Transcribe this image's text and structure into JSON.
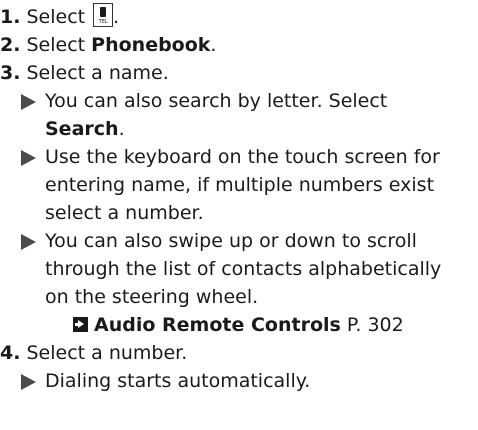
{
  "steps": [
    {
      "number": "1.",
      "text_before": "Select ",
      "icon_label": "TEL",
      "text_after": "."
    },
    {
      "number": "2.",
      "text_before": "Select ",
      "bold": "Phonebook",
      "text_after": "."
    },
    {
      "number": "3.",
      "text": "Select a name."
    },
    {
      "number": "4.",
      "text": "Select a number."
    }
  ],
  "substeps": {
    "step3": [
      {
        "line1": "You can also search by letter. Select",
        "bold": "Search",
        "after": "."
      },
      {
        "lines": [
          "Use the keyboard on the touch screen for",
          "entering name, if multiple numbers exist",
          "select a number."
        ]
      },
      {
        "lines": [
          "You can also swipe up or down to scroll",
          "through the list of contacts alphabetically",
          "on the steering wheel."
        ]
      }
    ],
    "step4": [
      {
        "text": "Dialing starts automatically."
      }
    ]
  },
  "reference": {
    "title": "Audio Remote Controls",
    "page": "P. 302"
  }
}
